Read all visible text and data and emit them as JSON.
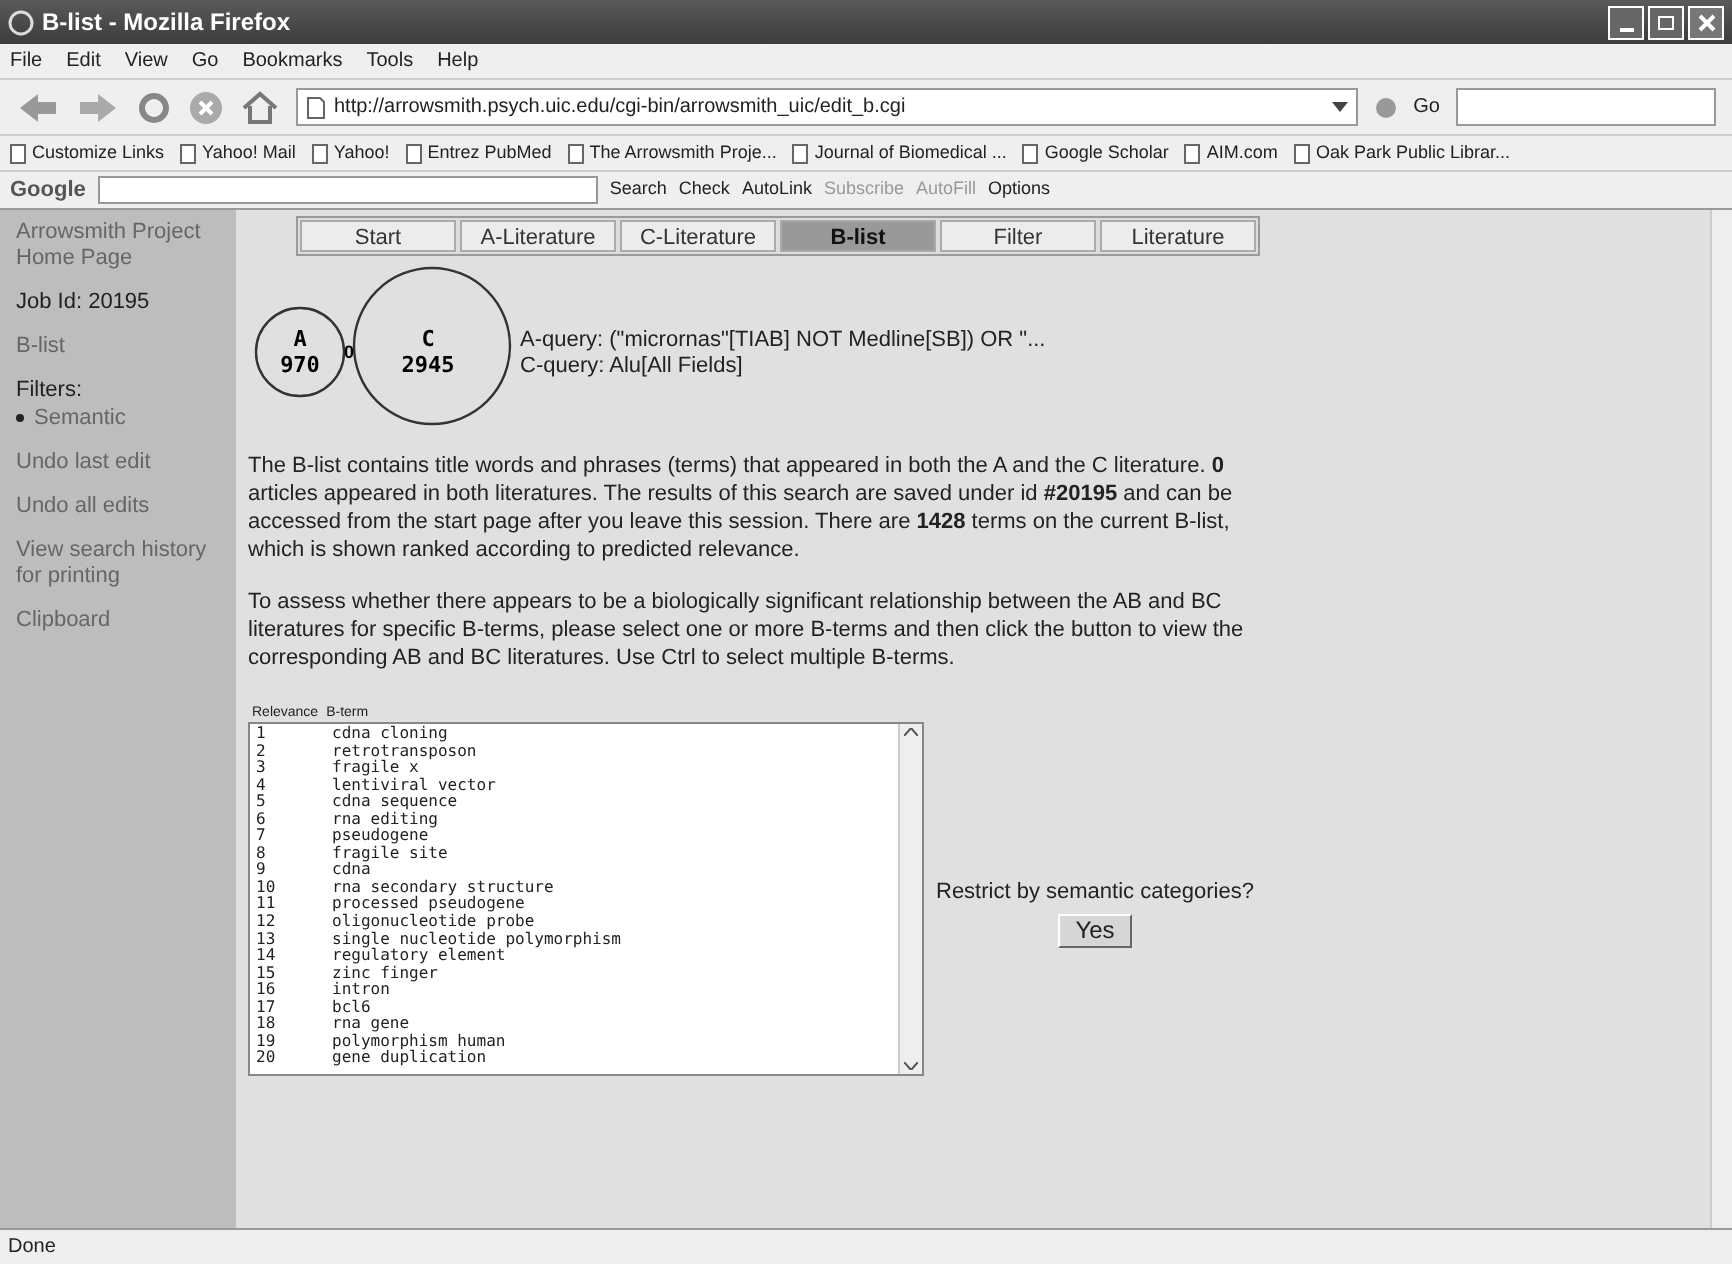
{
  "window": {
    "title": "B-list - Mozilla Firefox"
  },
  "menu": [
    "File",
    "Edit",
    "View",
    "Go",
    "Bookmarks",
    "Tools",
    "Help"
  ],
  "address": {
    "value": "http://arrowsmith.psych.uic.edu/cgi-bin/arrowsmith_uic/edit_b.cgi",
    "go": "Go"
  },
  "bookmarks": [
    "Customize Links",
    "Yahoo! Mail",
    "Yahoo!",
    "Entrez PubMed",
    "The Arrowsmith Proje...",
    "Journal of Biomedical ...",
    "Google Scholar",
    "AIM.com",
    "Oak Park Public Librar..."
  ],
  "google_toolbar": {
    "logo": "Google",
    "items": [
      "Search",
      "Check",
      "AutoLink",
      "Subscribe",
      "AutoFill",
      "Options"
    ]
  },
  "sidebar": {
    "items": [
      {
        "text": "Arrowsmith Project Home Page",
        "kind": "link"
      },
      {
        "text": "Job Id: 20195",
        "kind": "label"
      },
      {
        "text": "B-list",
        "kind": "link"
      },
      {
        "text": "Filters:",
        "kind": "label"
      },
      {
        "text": "Semantic",
        "kind": "bullet"
      },
      {
        "text": "Undo last edit",
        "kind": "link"
      },
      {
        "text": "Undo all edits",
        "kind": "link"
      },
      {
        "text": "View search history for printing",
        "kind": "link"
      },
      {
        "text": "Clipboard",
        "kind": "link"
      }
    ]
  },
  "tabs": [
    {
      "label": "Start",
      "selected": false
    },
    {
      "label": "A-Literature",
      "selected": false
    },
    {
      "label": "C-Literature",
      "selected": false
    },
    {
      "label": "B-list",
      "selected": true
    },
    {
      "label": "Filter",
      "selected": false
    },
    {
      "label": "Literature",
      "selected": false
    }
  ],
  "venn": {
    "a_label": "A",
    "a_count": "970",
    "overlap": "0",
    "c_label": "C",
    "c_count": "2945",
    "a_query": "A-query: (\"micrornas\"[TIAB] NOT Medline[SB]) OR \"...",
    "c_query": "C-query: Alu[All Fields]"
  },
  "paragraphs": [
    "The B-list contains title words and phrases (terms) that appeared in both the A and the C literature. **0** articles appeared in both literatures. The results of this search are saved under id **#20195** and can be accessed from the start page after you leave this session. There are **1428** terms on the current B-list, which is shown ranked according to predicted relevance.",
    "To assess whether there appears to be a biologically significant relationship between the AB and BC literatures for specific B-terms, please select one or more B-terms and then click the button to view the corresponding AB and BC literatures. Use Ctrl to select multiple B-terms."
  ],
  "list": {
    "columns": [
      "Relevance",
      "B-term"
    ],
    "rows": [
      [
        "1",
        "cdna cloning"
      ],
      [
        "2",
        "retrotransposon"
      ],
      [
        "3",
        "fragile x"
      ],
      [
        "4",
        "lentiviral vector"
      ],
      [
        "5",
        "cdna sequence"
      ],
      [
        "6",
        "rna editing"
      ],
      [
        "7",
        "pseudogene"
      ],
      [
        "8",
        "fragile site"
      ],
      [
        "9",
        "cdna"
      ],
      [
        "10",
        "rna secondary structure"
      ],
      [
        "11",
        "processed pseudogene"
      ],
      [
        "12",
        "oligonucleotide probe"
      ],
      [
        "13",
        "single nucleotide polymorphism"
      ],
      [
        "14",
        "regulatory element"
      ],
      [
        "15",
        "zinc finger"
      ],
      [
        "16",
        "intron"
      ],
      [
        "17",
        "bcl6"
      ],
      [
        "18",
        "rna gene"
      ],
      [
        "19",
        "polymorphism human"
      ],
      [
        "20",
        "gene duplication"
      ]
    ]
  },
  "restrict": {
    "question": "Restrict by semantic categories?",
    "button": "Yes"
  },
  "status_bar": "Done"
}
